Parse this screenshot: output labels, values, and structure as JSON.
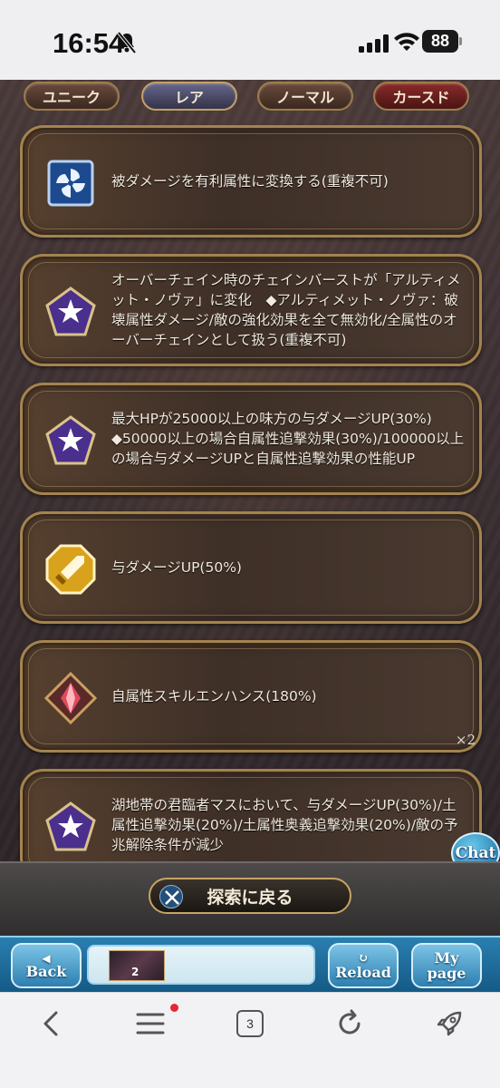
{
  "status_bar": {
    "time": "16:54",
    "battery": "88",
    "icons": [
      "bell-muted-icon",
      "signal-icon",
      "wifi-icon",
      "battery-icon"
    ]
  },
  "tabs": [
    {
      "label": "ユニーク",
      "state": "inactive"
    },
    {
      "label": "レア",
      "state": "active"
    },
    {
      "label": "ノーマル",
      "state": "inactive"
    },
    {
      "label": "カースド",
      "state": "inactive"
    }
  ],
  "cards": [
    {
      "icon": "pinwheel-icon",
      "text": "被ダメージを有利属性に変換する(重複不可)"
    },
    {
      "icon": "star-pentagon-icon",
      "text": "オーバーチェイン時のチェインバーストが「アルティメット・ノヴァ」に変化　◆アルティメット・ノヴァ：破壊属性ダメージ/敵の強化効果を全て無効化/全属性のオーバーチェインとして扱う(重複不可)"
    },
    {
      "icon": "star-pentagon-icon",
      "text": "最大HPが25000以上の味方の与ダメージUP(30%)　◆50000以上の場合自属性追撃効果(30%)/100000以上の場合与ダメージUPと自属性追撃効果の性能UP"
    },
    {
      "icon": "sword-octagon-icon",
      "text": "与ダメージUP(50%)"
    },
    {
      "icon": "red-crystal-icon",
      "text": "自属性スキルエンハンス(180%)",
      "count": "×2"
    },
    {
      "icon": "star-pentagon-icon",
      "text": "湖地帯の君臨者マスにおいて、与ダメージUP(30%)/土属性追撃効果(20%)/土属性奥義追撃効果(20%)/敵の予兆解除条件が減少"
    }
  ],
  "chat_label": "Chat",
  "explore_button": "探索に戻る",
  "game_nav": {
    "back": "Back",
    "thumb_badge": "2",
    "reload": "Reload",
    "mypage_line1": "My",
    "mypage_line2": "page"
  },
  "browser_bar": {
    "tab_count": "3",
    "icons": [
      "back-arrow-icon",
      "menu-icon",
      "tabs-icon",
      "refresh-icon",
      "rocket-icon"
    ]
  }
}
